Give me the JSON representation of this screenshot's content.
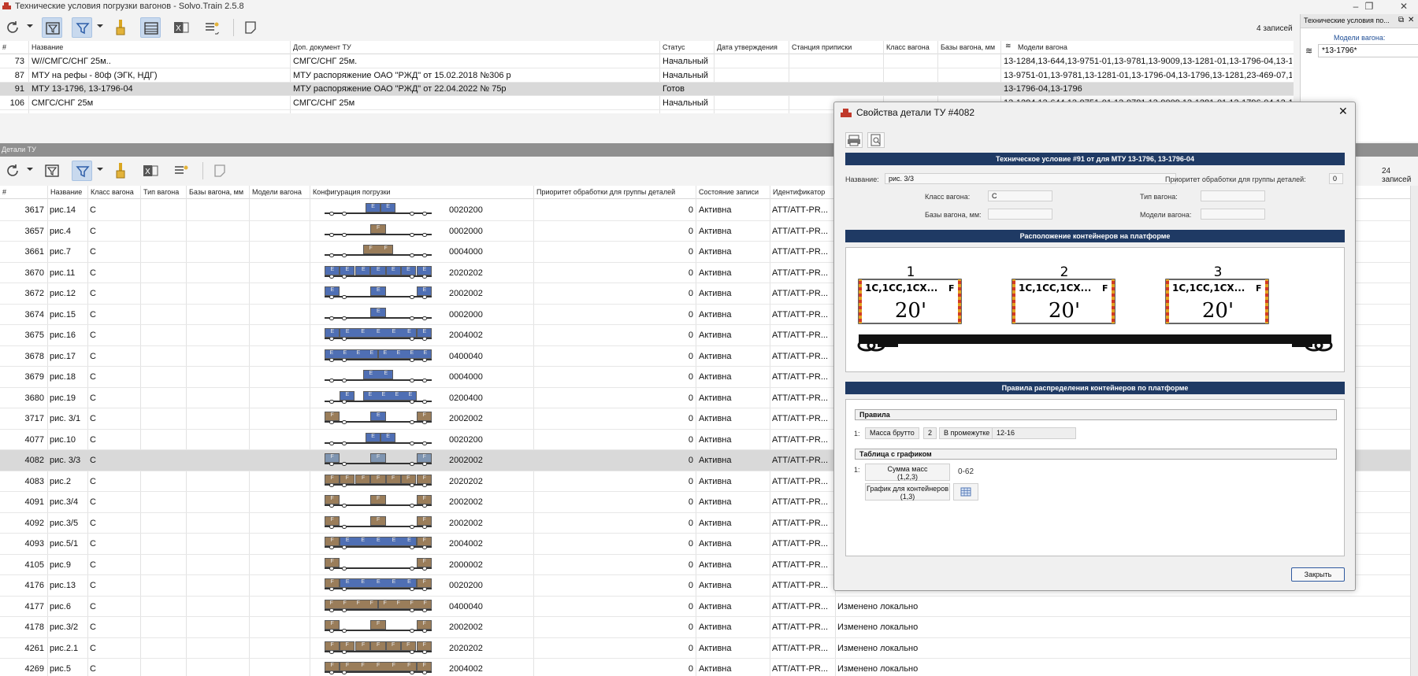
{
  "window": {
    "title": "Технические условия погрузки вагонов - Solvo.Train 2.5.8"
  },
  "top": {
    "count": "4 записей",
    "columns": [
      "#",
      "Название",
      "Доп. документ ТУ",
      "Статус",
      "Дата утверждения",
      "Станция приписки",
      "Класс вагона",
      "Базы вагона, мм",
      "Модели вагона"
    ],
    "rows": [
      {
        "id": "73",
        "name": "W//СМГС/СНГ 25м..",
        "doc": "СМГС/СНГ 25м.",
        "status": "Начальный",
        "models": "13-1284,13-644,13-9751-01,13-9781,13-9009,13-1281-01,13-1796-04,13-1796"
      },
      {
        "id": "87",
        "name": "МТУ на рефы - 80ф (ЭГК, НДГ)",
        "doc": "МТУ распоряжение ОАО \"РЖД\" от 15.02.2018  №306 р",
        "status": "Начальный",
        "models": "13-9751-01,13-9781,13-1281-01,13-1796-04,13-1796,13-1281,23-469-07,13-7"
      },
      {
        "id": "91",
        "name": "МТУ 13-1796, 13-1796-04",
        "doc": "МТУ распоряжение ОАО \"РЖД\" от 22.04.2022 № 75р",
        "status": "Готов",
        "models": "13-1796-04,13-1796",
        "selected": true
      },
      {
        "id": "106",
        "name": "СМГС/СНГ 25м",
        "doc": "СМГС/СНГ 25м",
        "status": "Начальный",
        "models": "13-1284,13-644,13-9751-01,13-9781,13-9009,13-1281-01,13-1796-04,13-1796"
      }
    ]
  },
  "filter_panel": {
    "title": "Технические условия по...",
    "label": "Модели вагона:",
    "value": "*13-1796*"
  },
  "details": {
    "section_title": "Детали ТУ",
    "count": "24 записей",
    "columns": [
      "#",
      "Название",
      "Класс вагона",
      "Тип вагона",
      "Базы вагона, мм",
      "Модели вагона",
      "Конфигурация погрузки",
      "Приоритет обработки для группы деталей",
      "Состояние записи",
      "Идентификатор"
    ],
    "rows": [
      {
        "id": "3617",
        "name": "рис.14",
        "cls": "С",
        "code": "0020200",
        "prio": "0",
        "state": "Активна",
        "ident": "АТТ/АТТ-PR...",
        "boxes": [
          [
            0.38,
            0.14,
            "blue",
            "E"
          ],
          [
            0.52,
            0.14,
            "blue",
            "E"
          ]
        ]
      },
      {
        "id": "3657",
        "name": "рис.4",
        "cls": "С",
        "code": "0002000",
        "prio": "0",
        "state": "Активна",
        "ident": "АТТ/АТТ-PR...",
        "boxes": [
          [
            0.43,
            0.14,
            "brown",
            "F"
          ]
        ]
      },
      {
        "id": "3661",
        "name": "рис.7",
        "cls": "С",
        "code": "0004000",
        "prio": "0",
        "state": "Активна",
        "ident": "АТТ/АТТ-PR...",
        "boxes": [
          [
            0.36,
            0.28,
            "brown",
            "F"
          ]
        ]
      },
      {
        "id": "3670",
        "name": "рис.11",
        "cls": "С",
        "code": "2020202",
        "prio": "0",
        "state": "Активна",
        "ident": "АТТ/АТТ-PR...",
        "boxes": [
          [
            0.0,
            0.14,
            "blue",
            "E"
          ],
          [
            0.14,
            0.14,
            "blue",
            "E"
          ],
          [
            0.29,
            0.14,
            "blue",
            "E"
          ],
          [
            0.43,
            0.14,
            "blue",
            "E"
          ],
          [
            0.57,
            0.14,
            "blue",
            "E"
          ],
          [
            0.71,
            0.14,
            "blue",
            "E"
          ],
          [
            0.86,
            0.14,
            "blue",
            "E"
          ]
        ]
      },
      {
        "id": "3672",
        "name": "рис.12",
        "cls": "С",
        "code": "2002002",
        "prio": "0",
        "state": "Активна",
        "ident": "АТТ/АТТ-PR...",
        "boxes": [
          [
            0.0,
            0.14,
            "blue",
            "E"
          ],
          [
            0.43,
            0.14,
            "blue",
            "E"
          ],
          [
            0.86,
            0.14,
            "blue",
            "E"
          ]
        ]
      },
      {
        "id": "3674",
        "name": "рис.15",
        "cls": "С",
        "code": "0002000",
        "prio": "0",
        "state": "Активна",
        "ident": "АТТ/АТТ-PR...",
        "boxes": [
          [
            0.43,
            0.14,
            "blue",
            "E"
          ]
        ]
      },
      {
        "id": "3675",
        "name": "рис.16",
        "cls": "С",
        "code": "2004002",
        "prio": "0",
        "state": "Активна",
        "ident": "АТТ/АТТ-PR...",
        "boxes": [
          [
            0.0,
            0.14,
            "blue",
            "E"
          ],
          [
            0.14,
            0.72,
            "blue",
            "E"
          ],
          [
            0.86,
            0.14,
            "blue",
            "E"
          ]
        ]
      },
      {
        "id": "3678",
        "name": "рис.17",
        "cls": "С",
        "code": "0400040",
        "prio": "0",
        "state": "Активна",
        "ident": "АТТ/АТТ-PR...",
        "boxes": [
          [
            0.0,
            0.5,
            "blue",
            "E"
          ],
          [
            0.5,
            0.5,
            "blue",
            "E"
          ]
        ]
      },
      {
        "id": "3679",
        "name": "рис.18",
        "cls": "С",
        "code": "0004000",
        "prio": "0",
        "state": "Активна",
        "ident": "АТТ/АТТ-PR...",
        "boxes": [
          [
            0.36,
            0.28,
            "blue",
            "E"
          ]
        ]
      },
      {
        "id": "3680",
        "name": "рис.19",
        "cls": "С",
        "code": "0200400",
        "prio": "0",
        "state": "Активна",
        "ident": "АТТ/АТТ-PR...",
        "boxes": [
          [
            0.14,
            0.14,
            "blue",
            "E"
          ],
          [
            0.36,
            0.5,
            "blue",
            "E"
          ]
        ]
      },
      {
        "id": "3717",
        "name": "рис. 3/1",
        "cls": "С",
        "code": "2002002",
        "prio": "0",
        "state": "Активна",
        "ident": "АТТ/АТТ-PR...",
        "boxes": [
          [
            0.0,
            0.14,
            "brown",
            "F"
          ],
          [
            0.43,
            0.14,
            "blue",
            "E"
          ],
          [
            0.86,
            0.14,
            "brown",
            "F"
          ]
        ]
      },
      {
        "id": "4077",
        "name": "рис.10",
        "cls": "С",
        "code": "0020200",
        "prio": "0",
        "state": "Активна",
        "ident": "АТТ/АТТ-PR...",
        "boxes": [
          [
            0.38,
            0.14,
            "blue",
            "E"
          ],
          [
            0.52,
            0.14,
            "blue",
            "E"
          ]
        ]
      },
      {
        "id": "4082",
        "name": "рис. 3/3",
        "cls": "С",
        "code": "2002002",
        "prio": "0",
        "state": "Активна",
        "ident": "АТТ/АТТ-PR...",
        "selected": true,
        "boxes": [
          [
            0.0,
            0.14,
            "gray",
            "F"
          ],
          [
            0.43,
            0.14,
            "gray",
            "F"
          ],
          [
            0.86,
            0.14,
            "gray",
            "F"
          ]
        ]
      },
      {
        "id": "4083",
        "name": "рис.2",
        "cls": "С",
        "code": "2020202",
        "prio": "0",
        "state": "Активна",
        "ident": "АТТ/АТТ-PR...",
        "boxes": [
          [
            0.0,
            0.14,
            "brown",
            "F"
          ],
          [
            0.14,
            0.14,
            "brown",
            "F"
          ],
          [
            0.29,
            0.14,
            "brown",
            "F"
          ],
          [
            0.43,
            0.14,
            "brown",
            "F"
          ],
          [
            0.57,
            0.14,
            "brown",
            "F"
          ],
          [
            0.71,
            0.14,
            "brown",
            "F"
          ],
          [
            0.86,
            0.14,
            "brown",
            "F"
          ]
        ]
      },
      {
        "id": "4091",
        "name": "рис.3/4",
        "cls": "С",
        "code": "2002002",
        "prio": "0",
        "state": "Активна",
        "ident": "АТТ/АТТ-PR...",
        "boxes": [
          [
            0.0,
            0.14,
            "brown",
            "F"
          ],
          [
            0.43,
            0.14,
            "brown",
            "F"
          ],
          [
            0.86,
            0.14,
            "brown",
            "F"
          ]
        ]
      },
      {
        "id": "4092",
        "name": "рис.3/5",
        "cls": "С",
        "code": "2002002",
        "prio": "0",
        "state": "Активна",
        "ident": "АТТ/АТТ-PR...",
        "boxes": [
          [
            0.0,
            0.14,
            "brown",
            "F"
          ],
          [
            0.43,
            0.14,
            "brown",
            "F"
          ],
          [
            0.86,
            0.14,
            "brown",
            "F"
          ]
        ]
      },
      {
        "id": "4093",
        "name": "рис.5/1",
        "cls": "С",
        "code": "2004002",
        "prio": "0",
        "state": "Активна",
        "ident": "АТТ/АТТ-PR...",
        "boxes": [
          [
            0.0,
            0.14,
            "brown",
            "F"
          ],
          [
            0.14,
            0.72,
            "blue",
            "E"
          ],
          [
            0.86,
            0.14,
            "brown",
            "F"
          ]
        ]
      },
      {
        "id": "4105",
        "name": "рис.9",
        "cls": "С",
        "code": "2000002",
        "prio": "0",
        "state": "Активна",
        "ident": "АТТ/АТТ-PR...",
        "boxes": [
          [
            0.0,
            0.14,
            "brown",
            "F"
          ],
          [
            0.86,
            0.14,
            "brown",
            "F"
          ]
        ]
      },
      {
        "id": "4176",
        "name": "рис.13",
        "cls": "С",
        "code": "0020200",
        "prio": "0",
        "state": "Активна",
        "ident": "АТТ/АТТ-PR...",
        "boxes": [
          [
            0.0,
            0.14,
            "brown",
            "F"
          ],
          [
            0.14,
            0.72,
            "blue",
            "E"
          ],
          [
            0.86,
            0.14,
            "brown",
            "F"
          ]
        ]
      },
      {
        "id": "4177",
        "name": "рис.6",
        "cls": "С",
        "code": "0400040",
        "prio": "0",
        "state": "Активна",
        "ident": "АТТ/АТТ-PR...",
        "extra": "Изменено локально",
        "boxes": [
          [
            0.0,
            0.5,
            "brown",
            "F"
          ],
          [
            0.5,
            0.5,
            "brown",
            "F"
          ]
        ]
      },
      {
        "id": "4178",
        "name": "рис.3/2",
        "cls": "С",
        "code": "2002002",
        "prio": "0",
        "state": "Активна",
        "ident": "АТТ/АТТ-PR...",
        "extra": "Изменено локально",
        "boxes": [
          [
            0.0,
            0.14,
            "brown",
            "F"
          ],
          [
            0.43,
            0.14,
            "brown",
            "F"
          ],
          [
            0.86,
            0.14,
            "brown",
            "F"
          ]
        ]
      },
      {
        "id": "4261",
        "name": "рис.2.1",
        "cls": "С",
        "code": "2020202",
        "prio": "0",
        "state": "Активна",
        "ident": "АТТ/АТТ-PR...",
        "extra": "Изменено локально",
        "boxes": [
          [
            0.0,
            0.14,
            "brown",
            "F"
          ],
          [
            0.14,
            0.14,
            "brown",
            "F"
          ],
          [
            0.29,
            0.14,
            "brown",
            "F"
          ],
          [
            0.43,
            0.14,
            "brown",
            "F"
          ],
          [
            0.57,
            0.14,
            "brown",
            "F"
          ],
          [
            0.71,
            0.14,
            "brown",
            "F"
          ],
          [
            0.86,
            0.14,
            "brown",
            "F"
          ]
        ]
      },
      {
        "id": "4269",
        "name": "рис.5",
        "cls": "С",
        "code": "2004002",
        "prio": "0",
        "state": "Активна",
        "ident": "АТТ/АТТ-PR...",
        "extra": "Изменено локально",
        "boxes": [
          [
            0.0,
            0.14,
            "brown",
            "F"
          ],
          [
            0.14,
            0.72,
            "brown",
            "F"
          ],
          [
            0.86,
            0.14,
            "brown",
            "F"
          ]
        ]
      }
    ]
  },
  "dialog": {
    "title": "Свойства детали ТУ #4082",
    "condition_bar": "Техническое условие #91 от  для МТУ 13-1796, 13-1796-04",
    "name_label": "Название:",
    "name_value": "рис. 3/3",
    "priority_label": "Приоритет обработки для группы деталей:",
    "priority_value": "0",
    "class_label": "Класс вагона:",
    "class_value": "С",
    "type_label": "Тип вагона:",
    "bases_label": "Базы вагона, мм:",
    "models_label": "Модели вагона:",
    "layout_bar": "Расположение контейнеров на платформе",
    "platform": {
      "slots": [
        {
          "num": "1",
          "types": "1С,1СС,1СХ...",
          "flag": "F",
          "size": "20'"
        },
        {
          "num": "2",
          "types": "1С,1СС,1СХ...",
          "flag": "F",
          "size": "20'"
        },
        {
          "num": "3",
          "types": "1С,1СС,1СХ...",
          "flag": "F",
          "size": "20'"
        }
      ]
    },
    "rules_bar": "Правила распределения контейнеров по платформе",
    "rules_header": "Правила",
    "rule": {
      "index": "1:",
      "param": "Масса брутто",
      "slot": "2",
      "op": "В промежутке",
      "range": "12-16"
    },
    "chart_header": "Таблица с графиком",
    "chart_rule": {
      "index": "1:",
      "sum_label": "Сумма масс\n(1,2,3)",
      "sum_range": "0-62",
      "graph_label": "График для контейнеров\n(1,3)"
    },
    "close_label": "Закрыть"
  }
}
